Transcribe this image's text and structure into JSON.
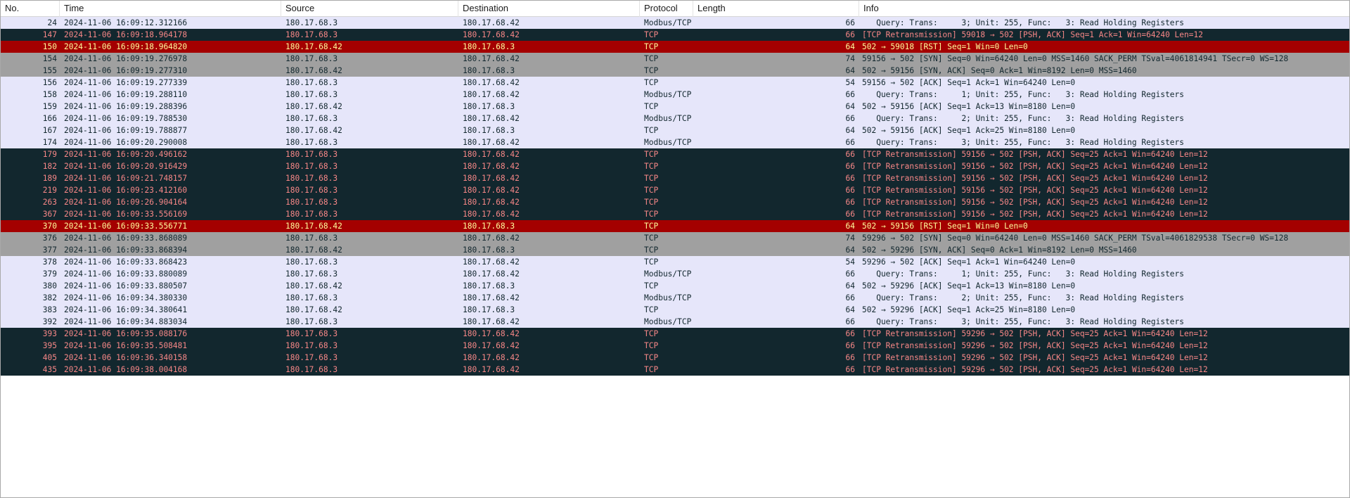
{
  "columns": [
    {
      "label": "No."
    },
    {
      "label": "Time"
    },
    {
      "label": "Source"
    },
    {
      "label": "Destination"
    },
    {
      "label": "Protocol"
    },
    {
      "label": "Length"
    },
    {
      "label": "Info"
    }
  ],
  "row_colors": {
    "normal": {
      "bg": "#e6e6fa",
      "fg": "#12272e"
    },
    "syn": {
      "bg": "#a0a0a0",
      "fg": "#12272e"
    },
    "retrans": {
      "bg": "#12272e",
      "fg": "#f78787"
    },
    "rst": {
      "bg": "#a40000",
      "fg": "#fffc9c"
    }
  },
  "packets": [
    {
      "no": "24",
      "time": "2024-11-06 16:09:12.312166",
      "src": "180.17.68.3",
      "dst": "180.17.68.42",
      "proto": "Modbus/TCP",
      "len": "66",
      "info": "   Query: Trans:     3; Unit: 255, Func:   3: Read Holding Registers",
      "style": "normal"
    },
    {
      "no": "147",
      "time": "2024-11-06 16:09:18.964178",
      "src": "180.17.68.3",
      "dst": "180.17.68.42",
      "proto": "TCP",
      "len": "66",
      "info": "[TCP Retransmission] 59018 → 502 [PSH, ACK] Seq=1 Ack=1 Win=64240 Len=12",
      "style": "retrans"
    },
    {
      "no": "150",
      "time": "2024-11-06 16:09:18.964820",
      "src": "180.17.68.42",
      "dst": "180.17.68.3",
      "proto": "TCP",
      "len": "64",
      "info": "502 → 59018 [RST] Seq=1 Win=0 Len=0",
      "style": "rst"
    },
    {
      "no": "154",
      "time": "2024-11-06 16:09:19.276978",
      "src": "180.17.68.3",
      "dst": "180.17.68.42",
      "proto": "TCP",
      "len": "74",
      "info": "59156 → 502 [SYN] Seq=0 Win=64240 Len=0 MSS=1460 SACK_PERM TSval=4061814941 TSecr=0 WS=128",
      "style": "syn"
    },
    {
      "no": "155",
      "time": "2024-11-06 16:09:19.277310",
      "src": "180.17.68.42",
      "dst": "180.17.68.3",
      "proto": "TCP",
      "len": "64",
      "info": "502 → 59156 [SYN, ACK] Seq=0 Ack=1 Win=8192 Len=0 MSS=1460",
      "style": "syn"
    },
    {
      "no": "156",
      "time": "2024-11-06 16:09:19.277339",
      "src": "180.17.68.3",
      "dst": "180.17.68.42",
      "proto": "TCP",
      "len": "54",
      "info": "59156 → 502 [ACK] Seq=1 Ack=1 Win=64240 Len=0",
      "style": "normal"
    },
    {
      "no": "158",
      "time": "2024-11-06 16:09:19.288110",
      "src": "180.17.68.3",
      "dst": "180.17.68.42",
      "proto": "Modbus/TCP",
      "len": "66",
      "info": "   Query: Trans:     1; Unit: 255, Func:   3: Read Holding Registers",
      "style": "normal"
    },
    {
      "no": "159",
      "time": "2024-11-06 16:09:19.288396",
      "src": "180.17.68.42",
      "dst": "180.17.68.3",
      "proto": "TCP",
      "len": "64",
      "info": "502 → 59156 [ACK] Seq=1 Ack=13 Win=8180 Len=0",
      "style": "normal"
    },
    {
      "no": "166",
      "time": "2024-11-06 16:09:19.788530",
      "src": "180.17.68.3",
      "dst": "180.17.68.42",
      "proto": "Modbus/TCP",
      "len": "66",
      "info": "   Query: Trans:     2; Unit: 255, Func:   3: Read Holding Registers",
      "style": "normal"
    },
    {
      "no": "167",
      "time": "2024-11-06 16:09:19.788877",
      "src": "180.17.68.42",
      "dst": "180.17.68.3",
      "proto": "TCP",
      "len": "64",
      "info": "502 → 59156 [ACK] Seq=1 Ack=25 Win=8180 Len=0",
      "style": "normal"
    },
    {
      "no": "174",
      "time": "2024-11-06 16:09:20.290008",
      "src": "180.17.68.3",
      "dst": "180.17.68.42",
      "proto": "Modbus/TCP",
      "len": "66",
      "info": "   Query: Trans:     3; Unit: 255, Func:   3: Read Holding Registers",
      "style": "normal"
    },
    {
      "no": "179",
      "time": "2024-11-06 16:09:20.496162",
      "src": "180.17.68.3",
      "dst": "180.17.68.42",
      "proto": "TCP",
      "len": "66",
      "info": "[TCP Retransmission] 59156 → 502 [PSH, ACK] Seq=25 Ack=1 Win=64240 Len=12",
      "style": "retrans"
    },
    {
      "no": "182",
      "time": "2024-11-06 16:09:20.916429",
      "src": "180.17.68.3",
      "dst": "180.17.68.42",
      "proto": "TCP",
      "len": "66",
      "info": "[TCP Retransmission] 59156 → 502 [PSH, ACK] Seq=25 Ack=1 Win=64240 Len=12",
      "style": "retrans"
    },
    {
      "no": "189",
      "time": "2024-11-06 16:09:21.748157",
      "src": "180.17.68.3",
      "dst": "180.17.68.42",
      "proto": "TCP",
      "len": "66",
      "info": "[TCP Retransmission] 59156 → 502 [PSH, ACK] Seq=25 Ack=1 Win=64240 Len=12",
      "style": "retrans"
    },
    {
      "no": "219",
      "time": "2024-11-06 16:09:23.412160",
      "src": "180.17.68.3",
      "dst": "180.17.68.42",
      "proto": "TCP",
      "len": "66",
      "info": "[TCP Retransmission] 59156 → 502 [PSH, ACK] Seq=25 Ack=1 Win=64240 Len=12",
      "style": "retrans"
    },
    {
      "no": "263",
      "time": "2024-11-06 16:09:26.904164",
      "src": "180.17.68.3",
      "dst": "180.17.68.42",
      "proto": "TCP",
      "len": "66",
      "info": "[TCP Retransmission] 59156 → 502 [PSH, ACK] Seq=25 Ack=1 Win=64240 Len=12",
      "style": "retrans"
    },
    {
      "no": "367",
      "time": "2024-11-06 16:09:33.556169",
      "src": "180.17.68.3",
      "dst": "180.17.68.42",
      "proto": "TCP",
      "len": "66",
      "info": "[TCP Retransmission] 59156 → 502 [PSH, ACK] Seq=25 Ack=1 Win=64240 Len=12",
      "style": "retrans"
    },
    {
      "no": "370",
      "time": "2024-11-06 16:09:33.556771",
      "src": "180.17.68.42",
      "dst": "180.17.68.3",
      "proto": "TCP",
      "len": "64",
      "info": "502 → 59156 [RST] Seq=1 Win=0 Len=0",
      "style": "rst"
    },
    {
      "no": "376",
      "time": "2024-11-06 16:09:33.868089",
      "src": "180.17.68.3",
      "dst": "180.17.68.42",
      "proto": "TCP",
      "len": "74",
      "info": "59296 → 502 [SYN] Seq=0 Win=64240 Len=0 MSS=1460 SACK_PERM TSval=4061829538 TSecr=0 WS=128",
      "style": "syn"
    },
    {
      "no": "377",
      "time": "2024-11-06 16:09:33.868394",
      "src": "180.17.68.42",
      "dst": "180.17.68.3",
      "proto": "TCP",
      "len": "64",
      "info": "502 → 59296 [SYN, ACK] Seq=0 Ack=1 Win=8192 Len=0 MSS=1460",
      "style": "syn"
    },
    {
      "no": "378",
      "time": "2024-11-06 16:09:33.868423",
      "src": "180.17.68.3",
      "dst": "180.17.68.42",
      "proto": "TCP",
      "len": "54",
      "info": "59296 → 502 [ACK] Seq=1 Ack=1 Win=64240 Len=0",
      "style": "normal"
    },
    {
      "no": "379",
      "time": "2024-11-06 16:09:33.880089",
      "src": "180.17.68.3",
      "dst": "180.17.68.42",
      "proto": "Modbus/TCP",
      "len": "66",
      "info": "   Query: Trans:     1; Unit: 255, Func:   3: Read Holding Registers",
      "style": "normal"
    },
    {
      "no": "380",
      "time": "2024-11-06 16:09:33.880507",
      "src": "180.17.68.42",
      "dst": "180.17.68.3",
      "proto": "TCP",
      "len": "64",
      "info": "502 → 59296 [ACK] Seq=1 Ack=13 Win=8180 Len=0",
      "style": "normal"
    },
    {
      "no": "382",
      "time": "2024-11-06 16:09:34.380330",
      "src": "180.17.68.3",
      "dst": "180.17.68.42",
      "proto": "Modbus/TCP",
      "len": "66",
      "info": "   Query: Trans:     2; Unit: 255, Func:   3: Read Holding Registers",
      "style": "normal"
    },
    {
      "no": "383",
      "time": "2024-11-06 16:09:34.380641",
      "src": "180.17.68.42",
      "dst": "180.17.68.3",
      "proto": "TCP",
      "len": "64",
      "info": "502 → 59296 [ACK] Seq=1 Ack=25 Win=8180 Len=0",
      "style": "normal"
    },
    {
      "no": "392",
      "time": "2024-11-06 16:09:34.883034",
      "src": "180.17.68.3",
      "dst": "180.17.68.42",
      "proto": "Modbus/TCP",
      "len": "66",
      "info": "   Query: Trans:     3; Unit: 255, Func:   3: Read Holding Registers",
      "style": "normal"
    },
    {
      "no": "393",
      "time": "2024-11-06 16:09:35.088176",
      "src": "180.17.68.3",
      "dst": "180.17.68.42",
      "proto": "TCP",
      "len": "66",
      "info": "[TCP Retransmission] 59296 → 502 [PSH, ACK] Seq=25 Ack=1 Win=64240 Len=12",
      "style": "retrans"
    },
    {
      "no": "395",
      "time": "2024-11-06 16:09:35.508481",
      "src": "180.17.68.3",
      "dst": "180.17.68.42",
      "proto": "TCP",
      "len": "66",
      "info": "[TCP Retransmission] 59296 → 502 [PSH, ACK] Seq=25 Ack=1 Win=64240 Len=12",
      "style": "retrans"
    },
    {
      "no": "405",
      "time": "2024-11-06 16:09:36.340158",
      "src": "180.17.68.3",
      "dst": "180.17.68.42",
      "proto": "TCP",
      "len": "66",
      "info": "[TCP Retransmission] 59296 → 502 [PSH, ACK] Seq=25 Ack=1 Win=64240 Len=12",
      "style": "retrans"
    },
    {
      "no": "435",
      "time": "2024-11-06 16:09:38.004168",
      "src": "180.17.68.3",
      "dst": "180.17.68.42",
      "proto": "TCP",
      "len": "66",
      "info": "[TCP Retransmission] 59296 → 502 [PSH, ACK] Seq=25 Ack=1 Win=64240 Len=12",
      "style": "retrans"
    }
  ]
}
